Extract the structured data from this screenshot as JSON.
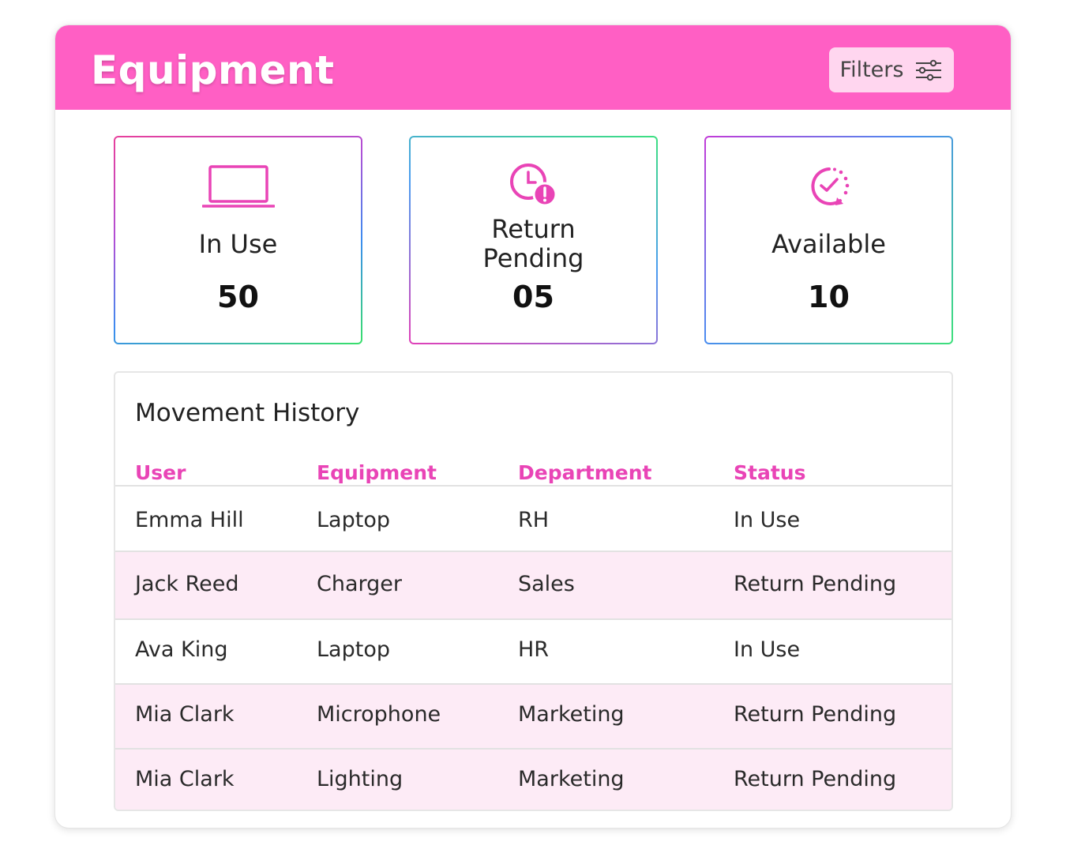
{
  "header": {
    "title": "Equipment",
    "filters_label": "Filters"
  },
  "stats": [
    {
      "label": "In Use",
      "value": "50",
      "icon": "laptop-icon"
    },
    {
      "label_line1": "Return",
      "label_line2": "Pending",
      "value": "05",
      "icon": "clock-alert-icon"
    },
    {
      "label": "Available",
      "value": "10",
      "icon": "clock-check-icon"
    }
  ],
  "history": {
    "title": "Movement History",
    "columns": [
      "User",
      "Equipment",
      "Department",
      "Status"
    ],
    "rows": [
      [
        "Emma Hill",
        "Laptop",
        "RH",
        "In Use"
      ],
      [
        "Jack Reed",
        "Charger",
        "Sales",
        "Return Pending"
      ],
      [
        "Ava King",
        "Laptop",
        "HR",
        "In Use"
      ],
      [
        "Mia Clark",
        "Microphone",
        "Marketing",
        "Return Pending"
      ],
      [
        "Mia Clark",
        "Lighting",
        "Marketing",
        "Return Pending"
      ]
    ]
  },
  "colors": {
    "accent": "#ff5fc4",
    "header_text": "#ffffff",
    "column_header": "#e944b6",
    "alt_row": "#fdebf6"
  }
}
